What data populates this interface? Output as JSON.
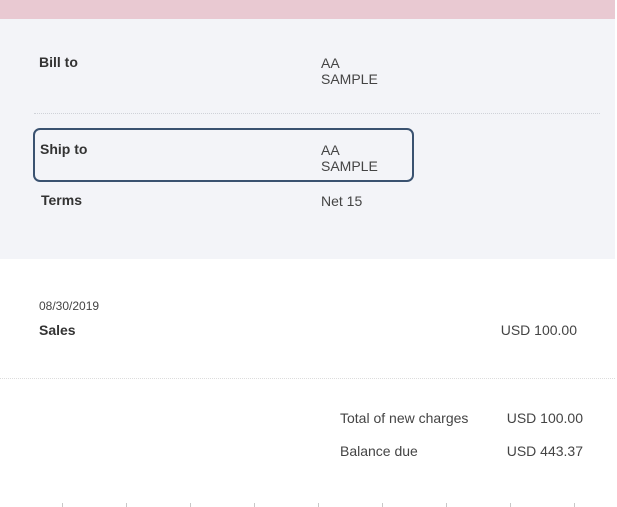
{
  "address": {
    "bill_to": {
      "label": "Bill to",
      "line1": "AA",
      "line2": "SAMPLE"
    },
    "ship_to": {
      "label": "Ship to",
      "line1": "AA",
      "line2": "SAMPLE"
    },
    "terms": {
      "label": "Terms",
      "value": "Net 15"
    }
  },
  "transaction": {
    "date": "08/30/2019",
    "label": "Sales",
    "amount": "USD 100.00"
  },
  "summary": {
    "total_label": "Total of new charges",
    "total_value": "USD 100.00",
    "balance_label": "Balance due",
    "balance_value": "USD 443.37"
  },
  "colors": {
    "top_bar": "#e9c9d2",
    "panel_bg": "#f3f4f8",
    "highlight": "#3a5270"
  }
}
